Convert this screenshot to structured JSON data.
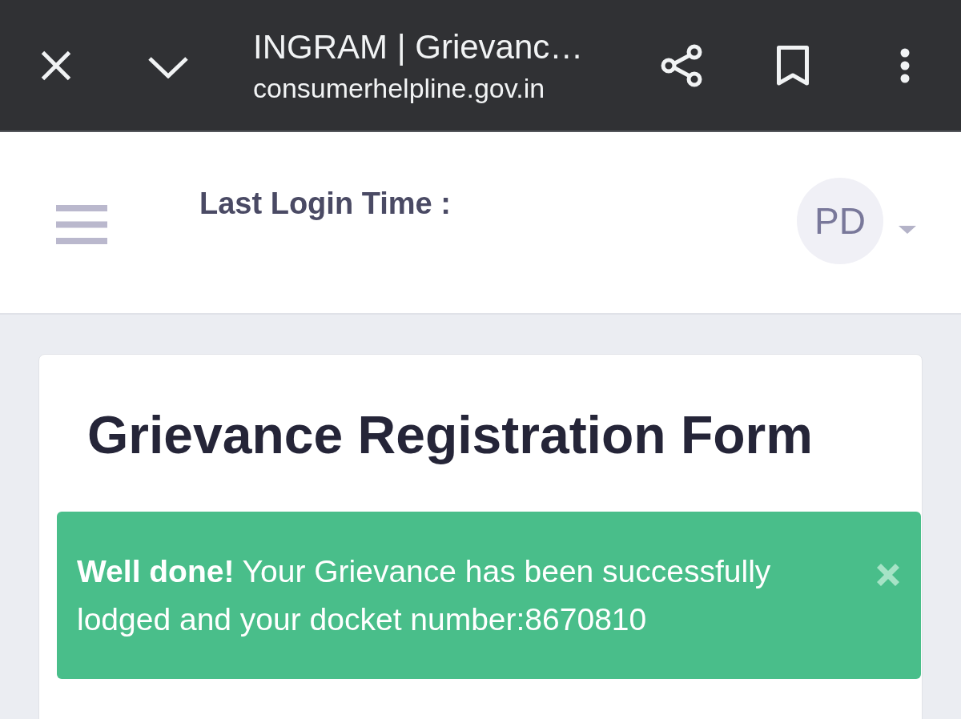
{
  "browser_bar": {
    "title": "INGRAM | Grievanc…",
    "url": "consumerhelpline.gov.in"
  },
  "header": {
    "label": "Last Login Time :",
    "avatar": {
      "initials": "PD"
    }
  },
  "form": {
    "title": "Grievance Registration Form",
    "alert": {
      "message": "**Well done!** Your Grievance has been successfully lodged and your docket number:8670810"
    }
  }
}
